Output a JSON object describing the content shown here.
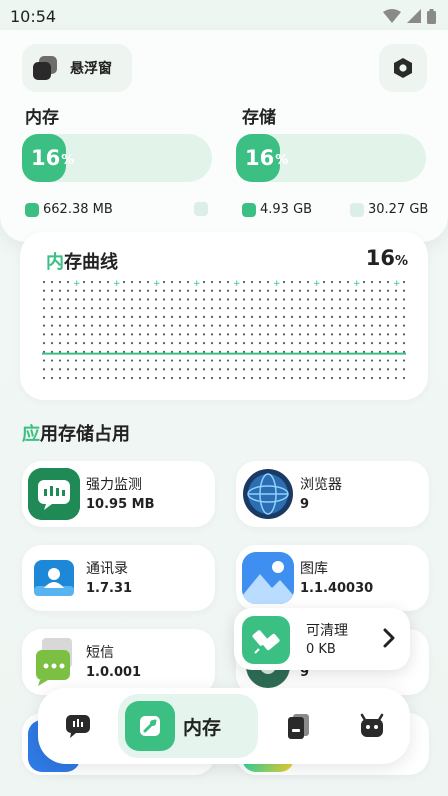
{
  "status": {
    "time": "10:54"
  },
  "header": {
    "float_window_label": "悬浮窗"
  },
  "memory": {
    "label": "内存",
    "percent": "16",
    "percent_value": 16,
    "percent_unit": "%",
    "used": "662.38 MB",
    "free": ""
  },
  "storage": {
    "label": "存储",
    "percent": "16",
    "percent_value": 16,
    "percent_unit": "%",
    "used": "4.93 GB",
    "free": "30.27 GB"
  },
  "curve": {
    "title_accent": "内",
    "title_rest": "存曲线",
    "percent": "16",
    "percent_unit": "%",
    "values": [
      16,
      16,
      16,
      16,
      16,
      16,
      16,
      16,
      16,
      16,
      16,
      16,
      16,
      16,
      16,
      16,
      16,
      16,
      16,
      16,
      16,
      16,
      16,
      16,
      16,
      16,
      16,
      16,
      16,
      16,
      16,
      16,
      16,
      16,
      16,
      16,
      16,
      16,
      16,
      16
    ]
  },
  "section": {
    "title_accent": "应",
    "title_rest": "用存储占用"
  },
  "apps": [
    {
      "name": "强力监测",
      "size": "10.95 MB",
      "icon": "chat-monitor-icon"
    },
    {
      "name": "浏览器",
      "size": "9",
      "icon": "globe-icon"
    },
    {
      "name": "通讯录",
      "size": "1.7.31",
      "icon": "contacts-icon"
    },
    {
      "name": "图库",
      "size": "1.1.40030",
      "icon": "gallery-icon"
    },
    {
      "name": "短信",
      "size": "1.0.001",
      "icon": "messages-icon"
    },
    {
      "name": "",
      "size": "9",
      "icon": "settings-gear-icon"
    }
  ],
  "cleanable": {
    "label": "可清理",
    "value": "0 KB"
  },
  "nav": {
    "active_label": "内存"
  },
  "colors": {
    "accent": "#3bbf83",
    "accent_light": "#e2f3ea"
  }
}
